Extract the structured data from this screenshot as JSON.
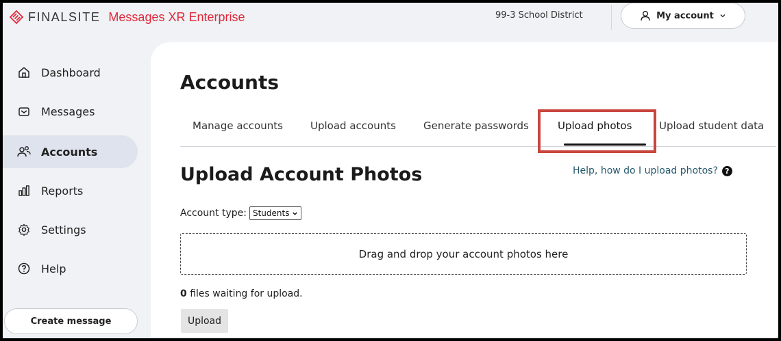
{
  "header": {
    "brand": "FINALSITE",
    "product": "Messages XR Enterprise",
    "district": "99-3 School District",
    "account_label": "My account",
    "brand_color": "#e0283a"
  },
  "sidebar": {
    "items": [
      {
        "label": "Dashboard",
        "icon": "home-icon"
      },
      {
        "label": "Messages",
        "icon": "message-icon"
      },
      {
        "label": "Accounts",
        "icon": "users-icon",
        "active": true
      },
      {
        "label": "Reports",
        "icon": "bar-chart-icon"
      },
      {
        "label": "Settings",
        "icon": "gear-icon"
      },
      {
        "label": "Help",
        "icon": "help-circle-icon"
      }
    ],
    "create_label": "Create message"
  },
  "main": {
    "title": "Accounts",
    "tabs": [
      {
        "label": "Manage accounts"
      },
      {
        "label": "Upload accounts"
      },
      {
        "label": "Generate passwords"
      },
      {
        "label": "Upload photos",
        "active": true
      },
      {
        "label": "Upload student data"
      }
    ],
    "section_title": "Upload Account Photos",
    "help_link": "Help, how do I upload photos?",
    "account_type_label": "Account type:",
    "account_type_value": "Students",
    "dropzone_text": "Drag and drop your account photos here",
    "waiting_count": "0",
    "waiting_text": " files waiting for upload.",
    "upload_label": "Upload",
    "highlight_color": "#c9453d"
  }
}
